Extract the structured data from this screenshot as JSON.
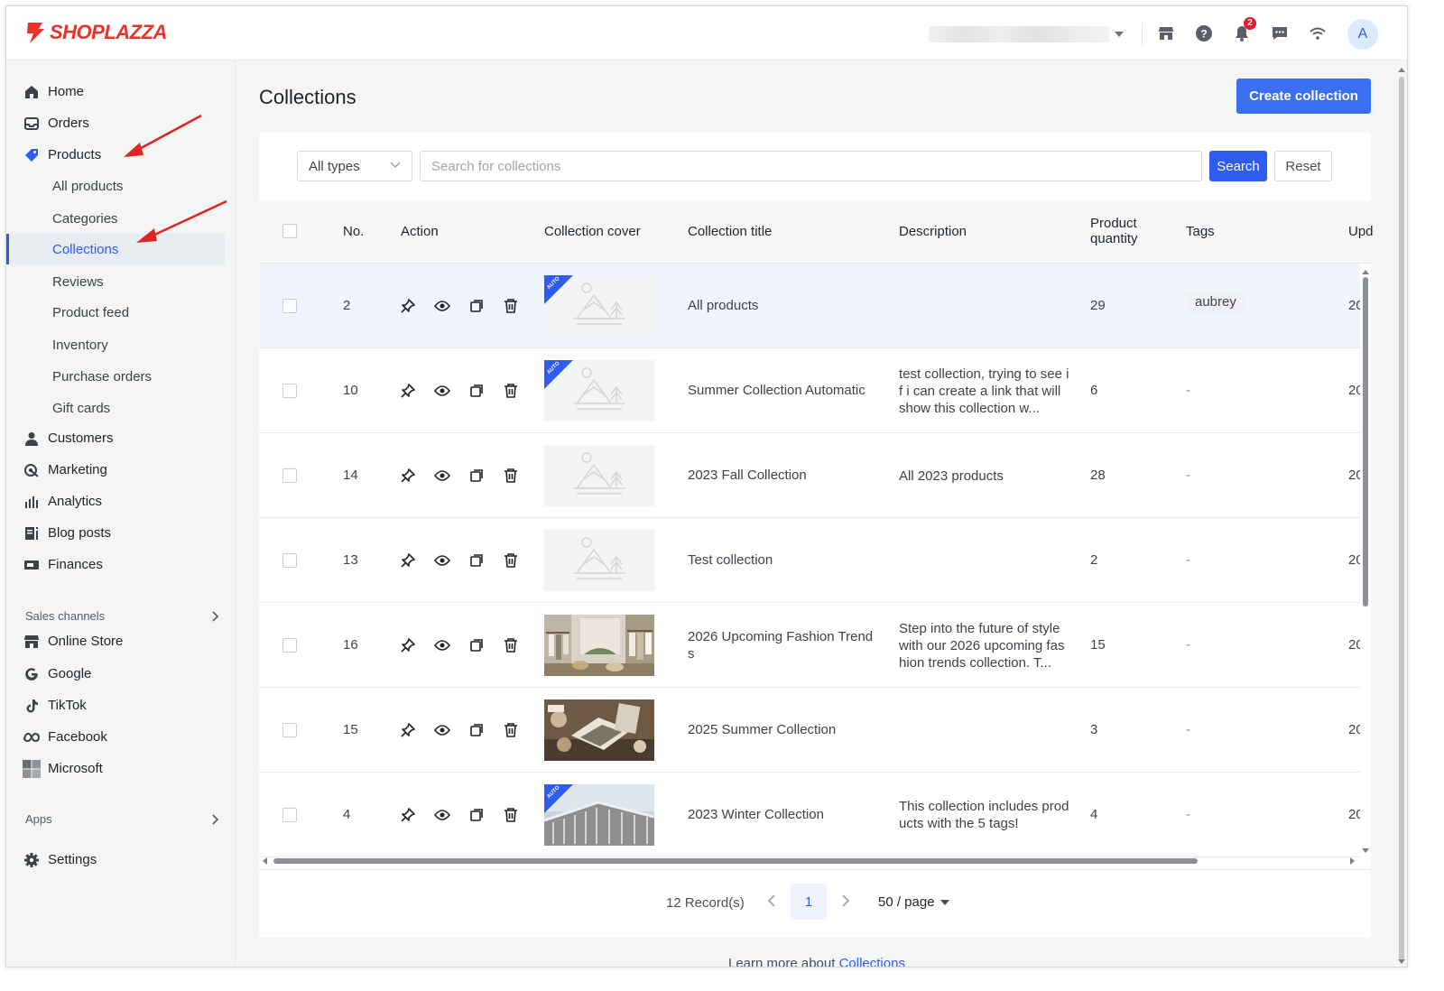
{
  "app": {
    "brand": "SHOPLAZZA",
    "notifications_count": "2",
    "avatar_initial": "A",
    "accent_color": "#2e5bf0",
    "brand_color": "#e8332a"
  },
  "sidebar": {
    "main_items": [
      {
        "label": "Home",
        "icon": "home-icon"
      },
      {
        "label": "Orders",
        "icon": "inbox-icon"
      },
      {
        "label": "Products",
        "icon": "tag-icon"
      }
    ],
    "product_subitems": [
      {
        "label": "All products"
      },
      {
        "label": "Categories"
      },
      {
        "label": "Collections",
        "active": true
      },
      {
        "label": "Reviews"
      },
      {
        "label": "Product feed"
      },
      {
        "label": "Inventory"
      },
      {
        "label": "Purchase orders"
      },
      {
        "label": "Gift cards"
      }
    ],
    "other_items": [
      {
        "label": "Customers",
        "icon": "user-icon"
      },
      {
        "label": "Marketing",
        "icon": "marketing-icon"
      },
      {
        "label": "Analytics",
        "icon": "bar-chart-icon"
      },
      {
        "label": "Blog posts",
        "icon": "blog-icon"
      },
      {
        "label": "Finances",
        "icon": "finance-icon"
      }
    ],
    "sales_channels_label": "Sales channels",
    "sales_channels": [
      {
        "label": "Online Store",
        "icon": "store-icon"
      },
      {
        "label": "Google",
        "icon": "google-icon"
      },
      {
        "label": "TikTok",
        "icon": "tiktok-icon"
      },
      {
        "label": "Facebook",
        "icon": "meta-icon"
      },
      {
        "label": "Microsoft",
        "icon": "microsoft-icon"
      }
    ],
    "apps_label": "Apps",
    "settings_label": "Settings"
  },
  "main": {
    "title": "Collections",
    "create_button": "Create collection",
    "filter": {
      "type_value": "All types",
      "search_placeholder": "Search for collections",
      "search_button": "Search",
      "reset_button": "Reset"
    },
    "columns": {
      "no": "No.",
      "action": "Action",
      "cover": "Collection cover",
      "title": "Collection title",
      "description": "Description",
      "quantity": "Product quantity",
      "tags": "Tags",
      "updated": "Upd"
    },
    "rows": [
      {
        "no": "2",
        "title": "All products",
        "description": "",
        "quantity": "29",
        "tags": "aubrey",
        "updated": "20",
        "cover": "placeholder",
        "auto": true,
        "highlight": true
      },
      {
        "no": "10",
        "title": "Summer Collection Automatic",
        "description": "test collection, trying to see if i can create a link that will show this collection w...",
        "quantity": "6",
        "tags": "-",
        "updated": "20",
        "cover": "placeholder",
        "auto": true
      },
      {
        "no": "14",
        "title": "2023 Fall Collection",
        "description": "All 2023 products",
        "quantity": "28",
        "tags": "-",
        "updated": "20",
        "cover": "placeholder",
        "auto": false
      },
      {
        "no": "13",
        "title": "Test collection",
        "description": "",
        "quantity": "2",
        "tags": "-",
        "updated": "20",
        "cover": "placeholder",
        "auto": false
      },
      {
        "no": "16",
        "title": "2026 Upcoming Fashion Trends",
        "description": "Step into the future of style with our 2026 upcoming fashion trends collection. T...",
        "quantity": "15",
        "tags": "-",
        "updated": "20",
        "cover": "photo-fashion",
        "auto": false
      },
      {
        "no": "15",
        "title": "2025 Summer Collection",
        "description": "",
        "quantity": "3",
        "tags": "-",
        "updated": "20",
        "cover": "photo-summer",
        "auto": false
      },
      {
        "no": "4",
        "title": "2023 Winter Collection",
        "description": "This collection includes products with the 5 tags!",
        "quantity": "4",
        "tags": "-",
        "updated": "20",
        "cover": "photo-winter",
        "auto": true
      }
    ],
    "auto_label": "AUTO",
    "pagination": {
      "records": "12 Record(s)",
      "current_page": "1",
      "per_page": "50 / page"
    },
    "learn_more_prefix": "Learn more about ",
    "learn_more_link": "Collections"
  }
}
